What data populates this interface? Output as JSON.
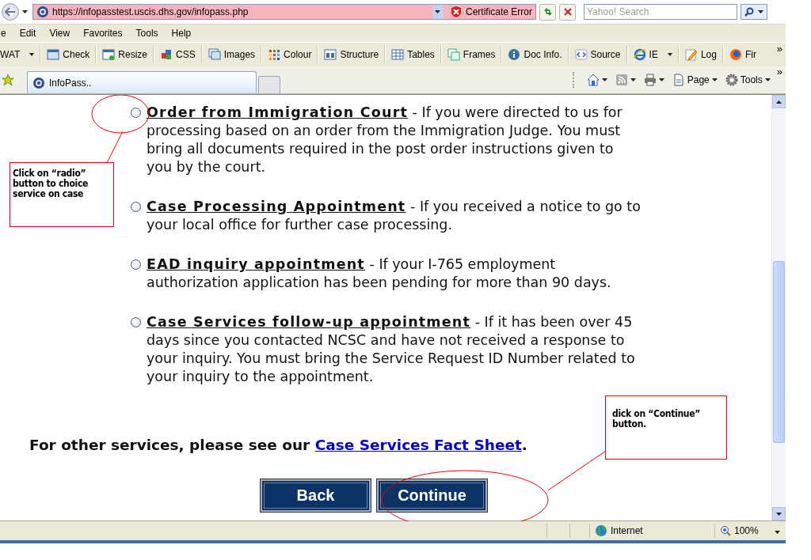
{
  "address_bar": {
    "url": "https://infopasstest.uscis.dhs.gov/infopass.php",
    "certificate": "Certificate Error",
    "search_placeholder": "Yahoo! Search"
  },
  "menu": [
    "e",
    "Edit",
    "View",
    "Favorites",
    "Tools",
    "Help"
  ],
  "toolbar": {
    "items": [
      {
        "label": "WAT",
        "dropdown": true
      },
      {
        "label": "Check",
        "dropdown": false
      },
      {
        "label": "Resize",
        "dropdown": false
      },
      {
        "label": "CSS",
        "dropdown": false
      },
      {
        "label": "Images",
        "dropdown": false
      },
      {
        "label": "Colour",
        "dropdown": false
      },
      {
        "label": "Structure",
        "dropdown": false
      },
      {
        "label": "Tables",
        "dropdown": false
      },
      {
        "label": "Frames",
        "dropdown": false
      },
      {
        "label": "Doc Info.",
        "dropdown": false
      },
      {
        "label": "Source",
        "dropdown": false
      },
      {
        "label": "IE",
        "dropdown": true
      },
      {
        "label": "Log",
        "dropdown": false
      },
      {
        "label": "Fir",
        "dropdown": false
      }
    ],
    "overflow": "»"
  },
  "tabs": [
    {
      "label": "InfoPass..",
      "selected": true
    }
  ],
  "command_bar": {
    "page": "Page",
    "tools": "Tools",
    "overflow": "»"
  },
  "options": [
    {
      "title": "Order from Immigration Court",
      "description": " - If you were directed to us for processing based on an order from the Immigration Judge. You must bring all documents required in the post order instructions given to you by the court.",
      "selected": false
    },
    {
      "title": "Case Processing Appointment",
      "description": " - If you received a notice to go to your local office for further case processing.",
      "selected": false
    },
    {
      "title": "EAD inquiry appointment",
      "description": " - If your I-765 employment authorization application has been pending for more than 90 days.",
      "selected": false
    },
    {
      "title": "Case Services follow-up appointment",
      "description": " - If it has been over 45 days since you contacted NCSC and have not received a response to your inquiry. You must bring the Service Request ID Number related to your inquiry to the appointment.",
      "selected": false
    }
  ],
  "footer": {
    "text": "For other services, please see our ",
    "link": "Case Services Fact Sheet",
    "end": "."
  },
  "buttons": [
    "Back",
    "Continue"
  ],
  "annotations": [
    {
      "text": "Click on “radio” button to choice service on case"
    },
    {
      "text": "dick on “Continue” button."
    }
  ],
  "status_bar": {
    "zone": "Internet",
    "zoom": "100%"
  }
}
